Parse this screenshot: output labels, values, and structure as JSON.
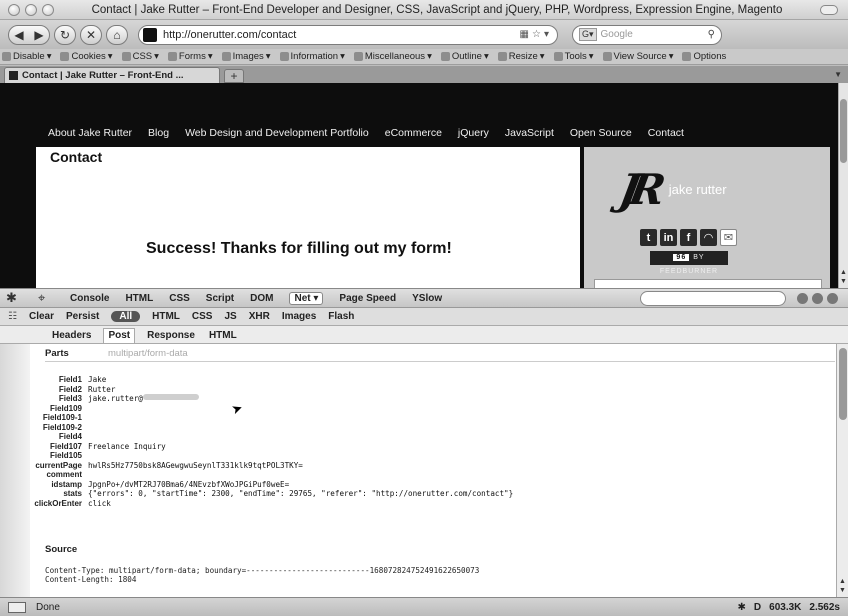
{
  "window": {
    "title": "Contact | Jake Rutter – Front-End Developer and Designer, CSS, JavaScript and jQuery, PHP, Wordpress, Expression Engine, Magento"
  },
  "navbar": {
    "url": "http://onerutter.com/contact",
    "search_placeholder": "Google"
  },
  "devtoolbar": {
    "items": [
      "Disable",
      "Cookies",
      "CSS",
      "Forms",
      "Images",
      "Information",
      "Miscellaneous",
      "Outline",
      "Resize",
      "Tools",
      "View Source",
      "Options"
    ]
  },
  "tabs": [
    {
      "label": "Contact | Jake Rutter – Front-End ..."
    }
  ],
  "site": {
    "nav": [
      "About Jake Rutter",
      "Blog",
      "Web Design and Development Portfolio",
      "eCommerce",
      "jQuery",
      "JavaScript",
      "Open Source",
      "Contact"
    ],
    "heading": "Contact",
    "message": "Success! Thanks for filling out my form!",
    "logo_mark": "JR",
    "logo_text": "jake rutter",
    "feed_count": "96",
    "feed_label": "BY FEEDBURNER"
  },
  "firebug": {
    "tabs": [
      "Console",
      "HTML",
      "CSS",
      "Script",
      "DOM",
      "Net ▾",
      "Page Speed",
      "YSlow"
    ],
    "active_tab": "Net ▾",
    "filters": [
      "Clear",
      "Persist",
      "All",
      "HTML",
      "CSS",
      "JS",
      "XHR",
      "Images",
      "Flash"
    ],
    "subtabs": [
      "Headers",
      "Post",
      "Response",
      "HTML"
    ],
    "active_subtab": "Post"
  },
  "post": {
    "parts_label": "Parts",
    "parts_type": "multipart/form-data",
    "fields": [
      {
        "name": "Field1",
        "value": "Jake"
      },
      {
        "name": "Field2",
        "value": "Rutter"
      },
      {
        "name": "Field3",
        "value": "jake.rutter@"
      },
      {
        "name": "Field109",
        "value": ""
      },
      {
        "name": "Field109-1",
        "value": ""
      },
      {
        "name": "Field109-2",
        "value": ""
      },
      {
        "name": "Field4",
        "value": ""
      },
      {
        "name": "Field107",
        "value": "Freelance Inquiry"
      },
      {
        "name": "Field105",
        "value": ""
      },
      {
        "name": "currentPage",
        "value": "hwlRs5Hz7750bsk8AGewgwuSeynlT331klk9tqtPOL3TKY="
      },
      {
        "name": "comment",
        "value": ""
      },
      {
        "name": "idstamp",
        "value": "JpgnPo+/dvMT2RJ70Bma6/4NEvzbfXWoJPGiPuf0weE="
      },
      {
        "name": "stats",
        "value": "{\"errors\": 0, \"startTime\": 2300, \"endTime\": 29765, \"referer\": \"http://onerutter.com/contact\"}"
      },
      {
        "name": "clickOrEnter",
        "value": "click"
      }
    ],
    "source_label": "Source",
    "source_lines": [
      "Content-Type: multipart/form-data; boundary=---------------------------168072824752491622650073",
      "Content-Length: 1804"
    ]
  },
  "status": {
    "text": "Done",
    "right": [
      "D",
      "603.3K",
      "2.562s"
    ]
  }
}
